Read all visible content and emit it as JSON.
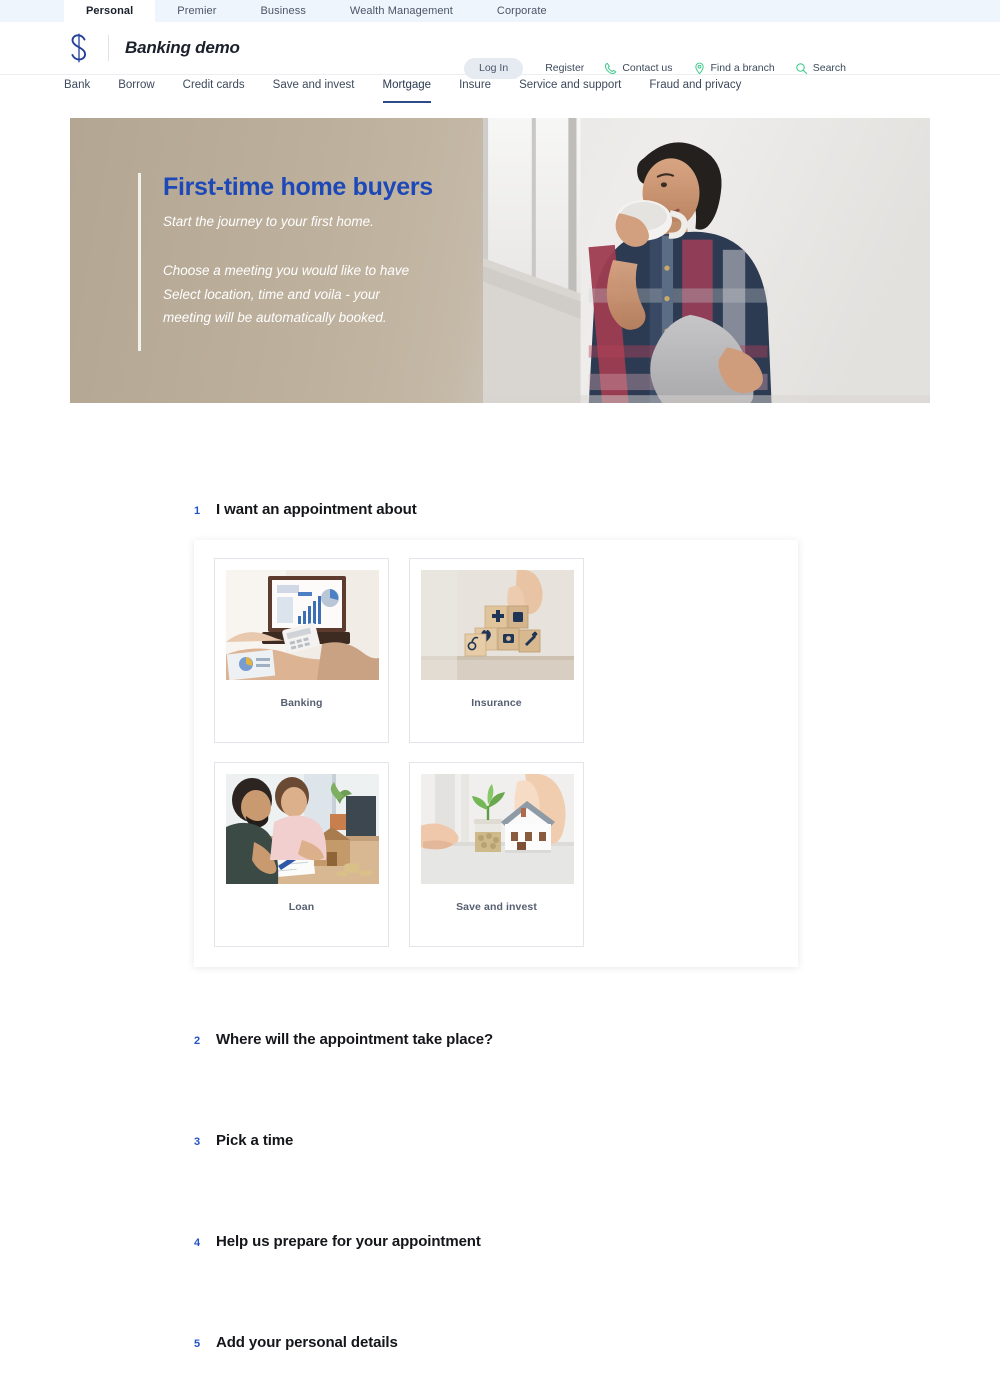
{
  "segments": [
    {
      "label": "Personal",
      "active": true
    },
    {
      "label": "Premier",
      "active": false
    },
    {
      "label": "Business",
      "active": false
    },
    {
      "label": "Wealth Management",
      "active": false
    },
    {
      "label": "Corporate",
      "active": false
    }
  ],
  "brand": {
    "logo_icon": "s-logo-icon",
    "name": "Banking demo"
  },
  "utility": {
    "login_label": "Log In",
    "links": [
      {
        "label": "Register",
        "icon": ""
      },
      {
        "label": "Contact us",
        "icon": "phone-icon"
      },
      {
        "label": "Find a branch",
        "icon": "location-pin-icon"
      },
      {
        "label": "Search",
        "icon": "search-icon"
      }
    ],
    "icon_color": "#3ec98a"
  },
  "mainnav": [
    {
      "label": "Bank",
      "active": false
    },
    {
      "label": "Borrow",
      "active": false
    },
    {
      "label": "Credit cards",
      "active": false
    },
    {
      "label": "Save and invest",
      "active": false
    },
    {
      "label": "Mortgage",
      "active": true
    },
    {
      "label": "Insure",
      "active": false
    },
    {
      "label": "Service and support",
      "active": false
    },
    {
      "label": "Fraud and privacy",
      "active": false
    }
  ],
  "hero": {
    "title": "First-time home buyers",
    "subtitle": "Start the journey to your first home.",
    "body_lines": [
      "Choose a meeting you would like to have",
      "Select location, time and voila - your",
      "meeting will be automatically booked."
    ],
    "title_color": "#1d48b8",
    "photo_alt": "woman-with-mug-by-window"
  },
  "steps": [
    {
      "number": "1",
      "title": "I want an appointment about"
    },
    {
      "number": "2",
      "title": "Where will the appointment take place?"
    },
    {
      "number": "3",
      "title": "Pick a time"
    },
    {
      "number": "4",
      "title": "Help us prepare for your appointment"
    },
    {
      "number": "5",
      "title": "Add your personal details"
    }
  ],
  "appointment_cards": [
    {
      "label": "Banking",
      "image": "laptop-charts-calculator-photo"
    },
    {
      "label": "Insurance",
      "image": "wooden-blocks-medical-icons-photo"
    },
    {
      "label": "Loan",
      "image": "couple-reviewing-documents-house-model-photo"
    },
    {
      "label": "Save and invest",
      "image": "coin-jar-plant-house-model-photo"
    }
  ]
}
